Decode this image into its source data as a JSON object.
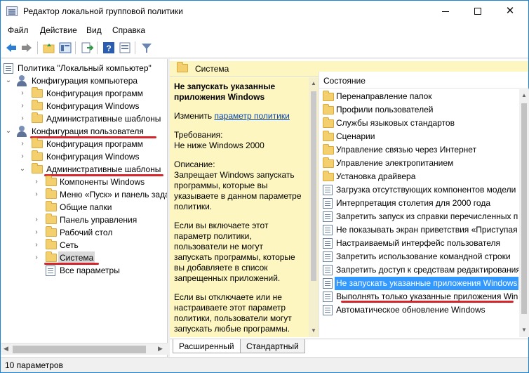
{
  "window": {
    "title": "Редактор локальной групповой политики"
  },
  "menu": [
    "Файл",
    "Действие",
    "Вид",
    "Справка"
  ],
  "toolbar": {
    "icons": [
      "back-arrow-icon",
      "forward-arrow-icon",
      "up-folder-icon",
      "show-hide-tree-icon",
      "export-list-icon",
      "help-icon",
      "properties-icon",
      "filter-icon"
    ]
  },
  "tree": {
    "root": "Политика \"Локальный компьютер\"",
    "computer_config": "Конфигурация компьютера",
    "cc_programs": "Конфигурация программ",
    "cc_windows": "Конфигурация Windows",
    "cc_admin": "Административные шаблоны",
    "user_config": "Конфигурация пользователя",
    "uc_programs": "Конфигурация программ",
    "uc_windows": "Конфигурация Windows",
    "uc_admin": "Административные шаблоны",
    "components": "Компоненты Windows",
    "start_menu": "Меню «Пуск» и панель зада",
    "shared_folders": "Общие папки",
    "control_panel": "Панель управления",
    "desktop": "Рабочий стол",
    "network": "Сеть",
    "system": "Система",
    "all_settings": "Все параметры"
  },
  "section": {
    "title": "Система"
  },
  "description": {
    "policy_title": "Не запускать указанные приложения Windows",
    "edit_prefix": "Изменить ",
    "edit_link": "параметр политики",
    "requirements": "Требования:\nНе ниже Windows 2000",
    "desc_label": "Описание:",
    "desc_text": "Запрещает Windows запускать программы, которые вы указываете в данном параметре политики.",
    "enabled_text": "Если вы включаете этот параметр политики, пользователи не могут запускать программы, которые вы добавляете в список запрещенных приложений.",
    "disabled_text": "Если вы отключаете или не настраиваете этот параметр политики, пользователи могут запускать любые программы."
  },
  "list": {
    "column_header": "Состояние",
    "items": [
      {
        "label": "Перенаправление папок",
        "type": "folder"
      },
      {
        "label": "Профили пользователей",
        "type": "folder"
      },
      {
        "label": "Службы языковых стандартов",
        "type": "folder"
      },
      {
        "label": "Сценарии",
        "type": "folder"
      },
      {
        "label": "Управление связью через Интернет",
        "type": "folder"
      },
      {
        "label": "Управление электропитанием",
        "type": "folder"
      },
      {
        "label": "Установка драйвера",
        "type": "folder"
      },
      {
        "label": "Загрузка отсутствующих компонентов модели",
        "type": "setting"
      },
      {
        "label": "Интерпретация столетия для 2000 года",
        "type": "setting"
      },
      {
        "label": "Запретить запуск из справки перечисленных п",
        "type": "setting"
      },
      {
        "label": "Не показывать экран приветствия «Приступая",
        "type": "setting"
      },
      {
        "label": "Настраиваемый интерфейс пользователя",
        "type": "setting"
      },
      {
        "label": "Запретить использование командной строки",
        "type": "setting"
      },
      {
        "label": "Запретить доступ к средствам редактирования",
        "type": "setting"
      },
      {
        "label": "Не запускать указанные приложения Windows",
        "type": "setting",
        "selected": true
      },
      {
        "label": "Выполнять только указанные приложения Win",
        "type": "setting"
      },
      {
        "label": "Автоматическое обновление Windows",
        "type": "setting"
      }
    ]
  },
  "tabs": [
    "Расширенный",
    "Стандартный"
  ],
  "status": {
    "text": "10 параметров"
  },
  "colors": {
    "accent_underline": "#d5262d",
    "selection": "#3399ff",
    "description_bg": "#fdf6c0"
  }
}
